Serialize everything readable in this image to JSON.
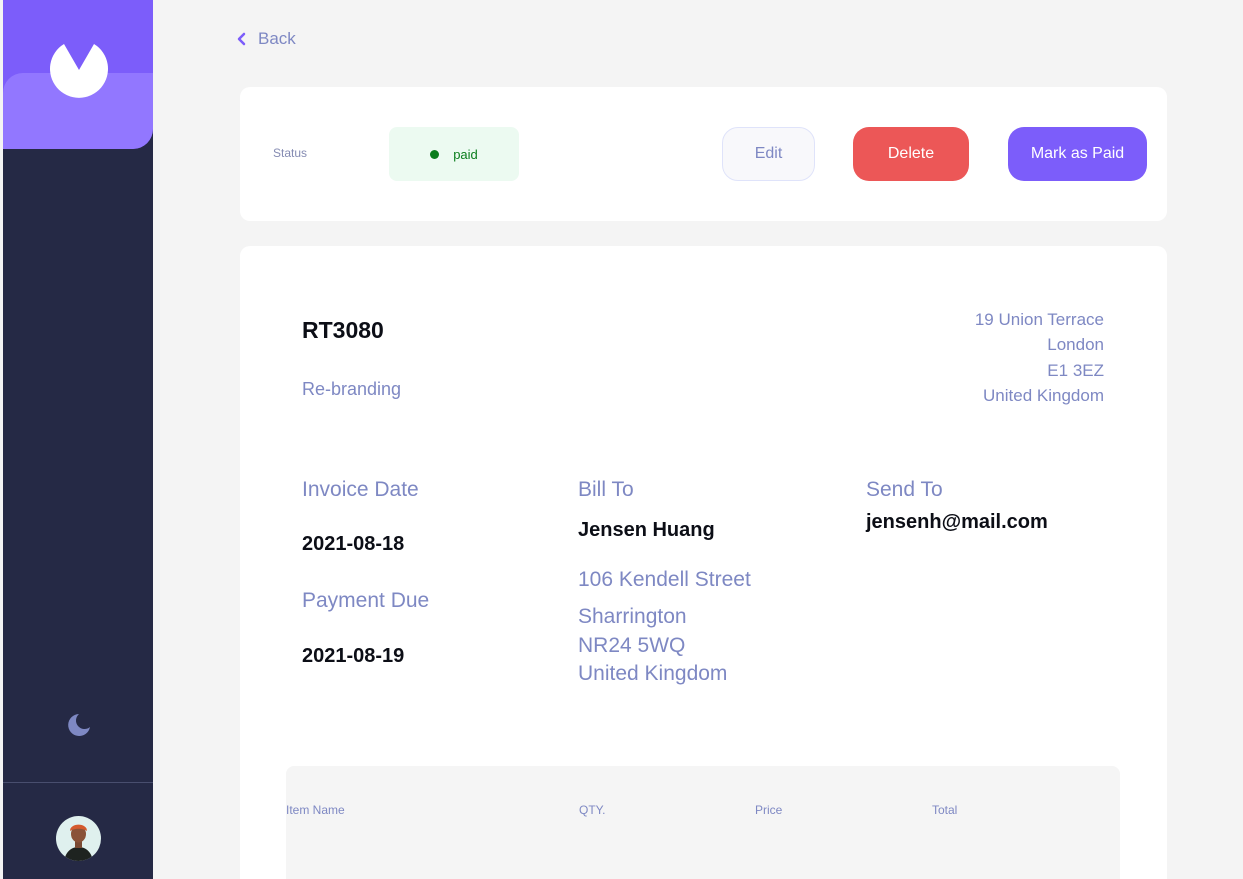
{
  "sidebar": {
    "logo_icon": "logo-icon",
    "theme_toggle_icon": "moon-icon",
    "avatar": "user-avatar"
  },
  "back": {
    "label": "Back"
  },
  "status": {
    "label": "Status",
    "value": "paid"
  },
  "actions": {
    "edit": "Edit",
    "delete": "Delete",
    "mark_paid": "Mark as Paid"
  },
  "invoice": {
    "id": "RT3080",
    "description": "Re-branding",
    "sender_address": {
      "street": "19 Union Terrace",
      "city": "London",
      "post_code": "E1 3EZ",
      "country": "United Kingdom"
    },
    "invoice_date_label": "Invoice Date",
    "invoice_date": "2021-08-18",
    "payment_due_label": "Payment Due",
    "payment_due": "2021-08-19",
    "bill_to_label": "Bill To",
    "client_name": "Jensen Huang",
    "client_address": {
      "street": "106 Kendell Street",
      "city": "Sharrington",
      "post_code": "NR24 5WQ",
      "country": "United Kingdom"
    },
    "send_to_label": "Send To",
    "client_email": "jensenh@mail.com"
  },
  "items_table": {
    "headers": [
      "Item Name",
      "QTY.",
      "Price",
      "Total"
    ]
  },
  "colors": {
    "primary": "#7c5dfa",
    "primary_light": "#9277ff",
    "danger": "#ec5757",
    "sidebar": "#252945",
    "paid": "#0a7d1c",
    "muted": "#7e88c3"
  }
}
